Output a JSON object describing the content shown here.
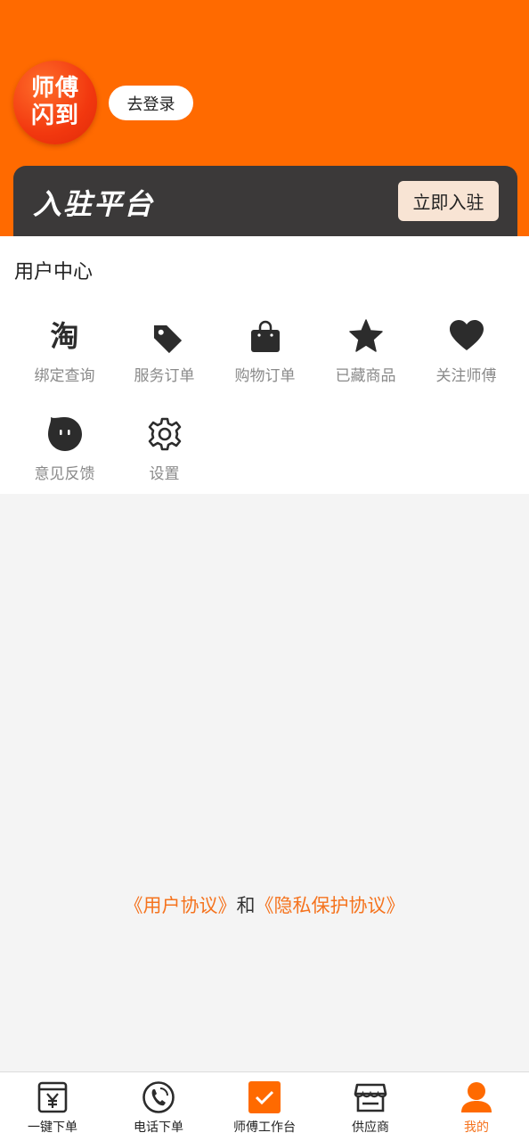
{
  "header": {
    "logo_line1": "师傅",
    "logo_line2": "闪到",
    "login_label": "去登录"
  },
  "banner": {
    "title": "入驻平台",
    "join_label": "立即入驻"
  },
  "user_center": {
    "title": "用户中心",
    "items": [
      {
        "label": "绑定查询",
        "icon": "tao-icon"
      },
      {
        "label": "服务订单",
        "icon": "tag-icon"
      },
      {
        "label": "购物订单",
        "icon": "shopping-bag-icon"
      },
      {
        "label": "已藏商品",
        "icon": "star-icon"
      },
      {
        "label": "关注师傅",
        "icon": "heart-icon"
      },
      {
        "label": "意见反馈",
        "icon": "chat-bubble-icon"
      },
      {
        "label": "设置",
        "icon": "gear-icon"
      }
    ],
    "tao_glyph": "淘"
  },
  "agreement": {
    "user_agreement": "《用户协议》",
    "conjunction": "和",
    "privacy_agreement": "《隐私保护协议》"
  },
  "tabbar": {
    "tabs": [
      {
        "label": "一键下单",
        "icon": "yen-order-icon"
      },
      {
        "label": "电话下单",
        "icon": "phone-icon"
      },
      {
        "label": "师傅工作台",
        "icon": "checkbox-icon"
      },
      {
        "label": "供应商",
        "icon": "store-icon"
      },
      {
        "label": "我的",
        "icon": "user-icon",
        "active": true
      }
    ],
    "yen_glyph": "¥"
  },
  "colors": {
    "brand_orange": "#ff6a00",
    "link_orange": "#f5731e",
    "banner_dark": "#3b3939",
    "join_button": "#f8e4d4"
  }
}
